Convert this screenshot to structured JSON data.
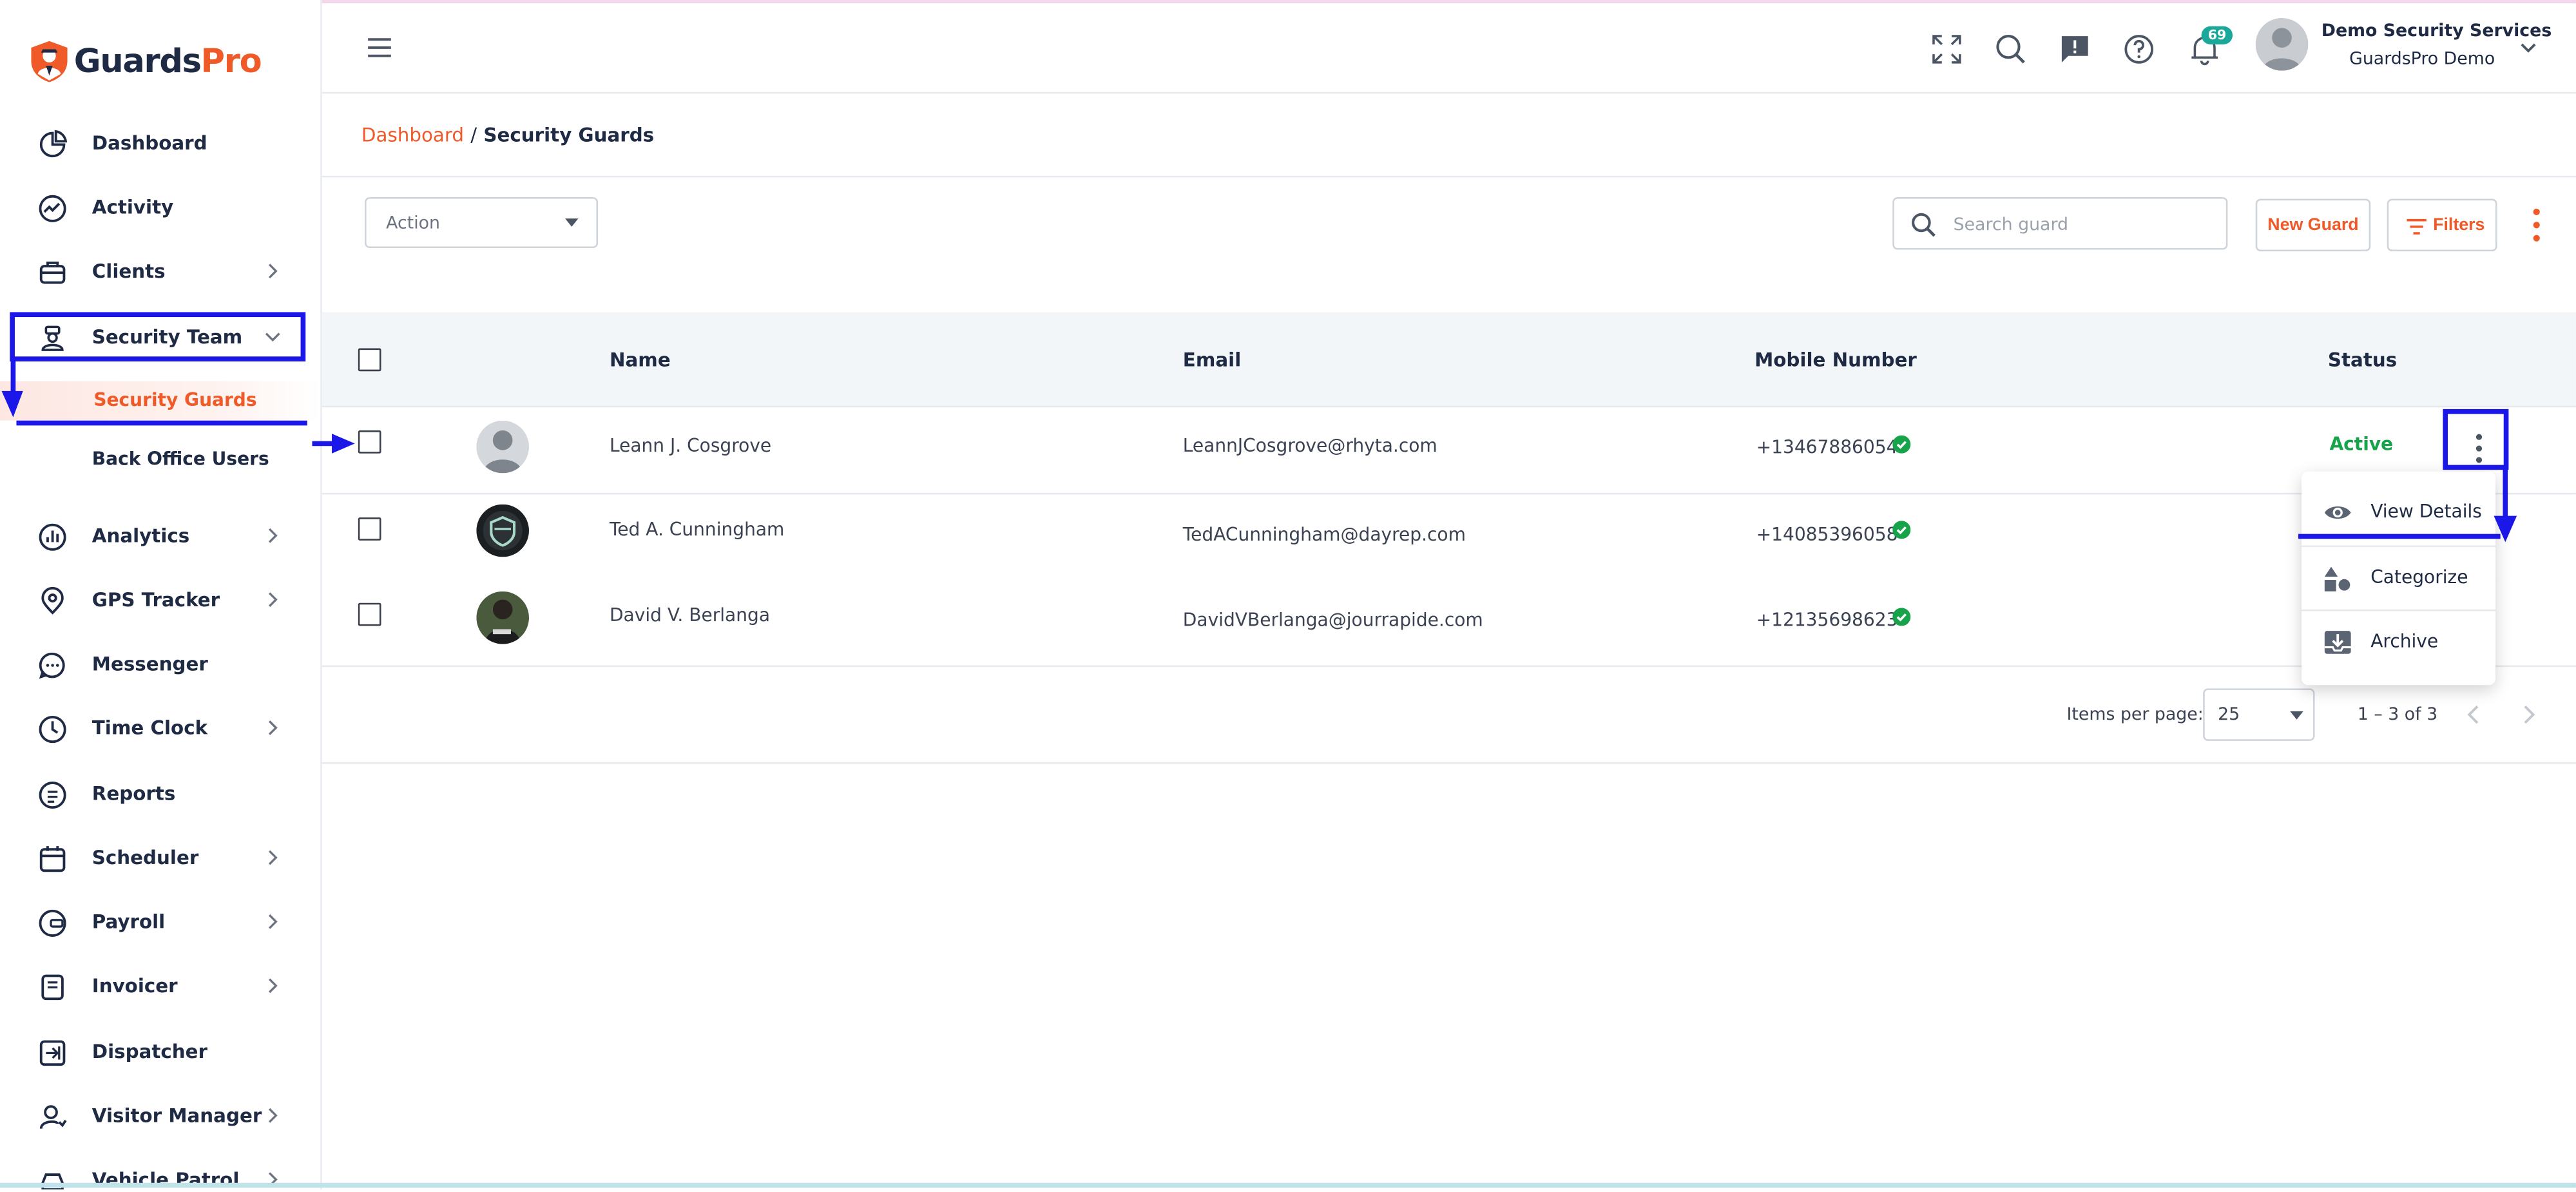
{
  "brand": {
    "logo_part1": "Guards",
    "logo_part2": "Pro"
  },
  "sidebar": {
    "items": [
      {
        "label": "Dashboard",
        "icon": "pie-chart-icon",
        "has_chevron": false
      },
      {
        "label": "Activity",
        "icon": "activity-icon",
        "has_chevron": false
      },
      {
        "label": "Clients",
        "icon": "briefcase-icon",
        "has_chevron": true
      },
      {
        "label": "Security Team",
        "icon": "guard-icon",
        "has_chevron": true,
        "expanded": true
      },
      {
        "label": "Analytics",
        "icon": "analytics-icon",
        "has_chevron": true
      },
      {
        "label": "GPS Tracker",
        "icon": "location-pin-icon",
        "has_chevron": true
      },
      {
        "label": "Messenger",
        "icon": "chat-bubble-icon",
        "has_chevron": false
      },
      {
        "label": "Time Clock",
        "icon": "clock-icon",
        "has_chevron": true
      },
      {
        "label": "Reports",
        "icon": "document-icon",
        "has_chevron": false
      },
      {
        "label": "Scheduler",
        "icon": "calendar-icon",
        "has_chevron": true
      },
      {
        "label": "Payroll",
        "icon": "wallet-icon",
        "has_chevron": true
      },
      {
        "label": "Invoicer",
        "icon": "invoice-icon",
        "has_chevron": true
      },
      {
        "label": "Dispatcher",
        "icon": "dispatch-icon",
        "has_chevron": false
      },
      {
        "label": "Visitor Manager",
        "icon": "visitor-icon",
        "has_chevron": true
      },
      {
        "label": "Vehicle Patrol",
        "icon": "car-icon",
        "has_chevron": true
      }
    ],
    "subitems": [
      {
        "label": "Security Guards",
        "active": true
      },
      {
        "label": "Back Office Users",
        "active": false
      }
    ]
  },
  "header": {
    "notification_count": "69",
    "user_company": "Demo Security Services",
    "user_name": "GuardsPro Demo"
  },
  "breadcrumb": {
    "root": "Dashboard",
    "separator": "/",
    "current": "Security Guards"
  },
  "toolbar": {
    "action_label": "Action",
    "search_placeholder": "Search guard",
    "new_guard_label": "New Guard",
    "filters_label": "Filters"
  },
  "table": {
    "columns": {
      "name": "Name",
      "email": "Email",
      "mobile": "Mobile Number",
      "status": "Status"
    },
    "rows": [
      {
        "name": "Leann J. Cosgrove",
        "email": "LeannJCosgrove@rhyta.com",
        "mobile": "+13467886054",
        "verified": true,
        "status": "Active"
      },
      {
        "name": "Ted A. Cunningham",
        "email": "TedACunningham@dayrep.com",
        "mobile": "+14085396058",
        "verified": true,
        "status": ""
      },
      {
        "name": "David V. Berlanga",
        "email": "DavidVBerlanga@jourrapide.com",
        "mobile": "+12135698623",
        "verified": true,
        "status": ""
      }
    ]
  },
  "pagination": {
    "items_per_page_label": "Items per page:",
    "items_per_page": "25",
    "range": "1 – 3 of 3"
  },
  "row_menu": {
    "items": [
      {
        "label": "View Details",
        "icon": "eye-icon"
      },
      {
        "label": "Categorize",
        "icon": "shapes-icon"
      },
      {
        "label": "Archive",
        "icon": "archive-icon"
      }
    ]
  },
  "colors": {
    "brand_orange": "#f05a28",
    "dark_navy": "#1f2a44",
    "active_green": "#17a34a",
    "annotation_blue": "#1b17e8",
    "badge_teal": "#19a89a"
  }
}
